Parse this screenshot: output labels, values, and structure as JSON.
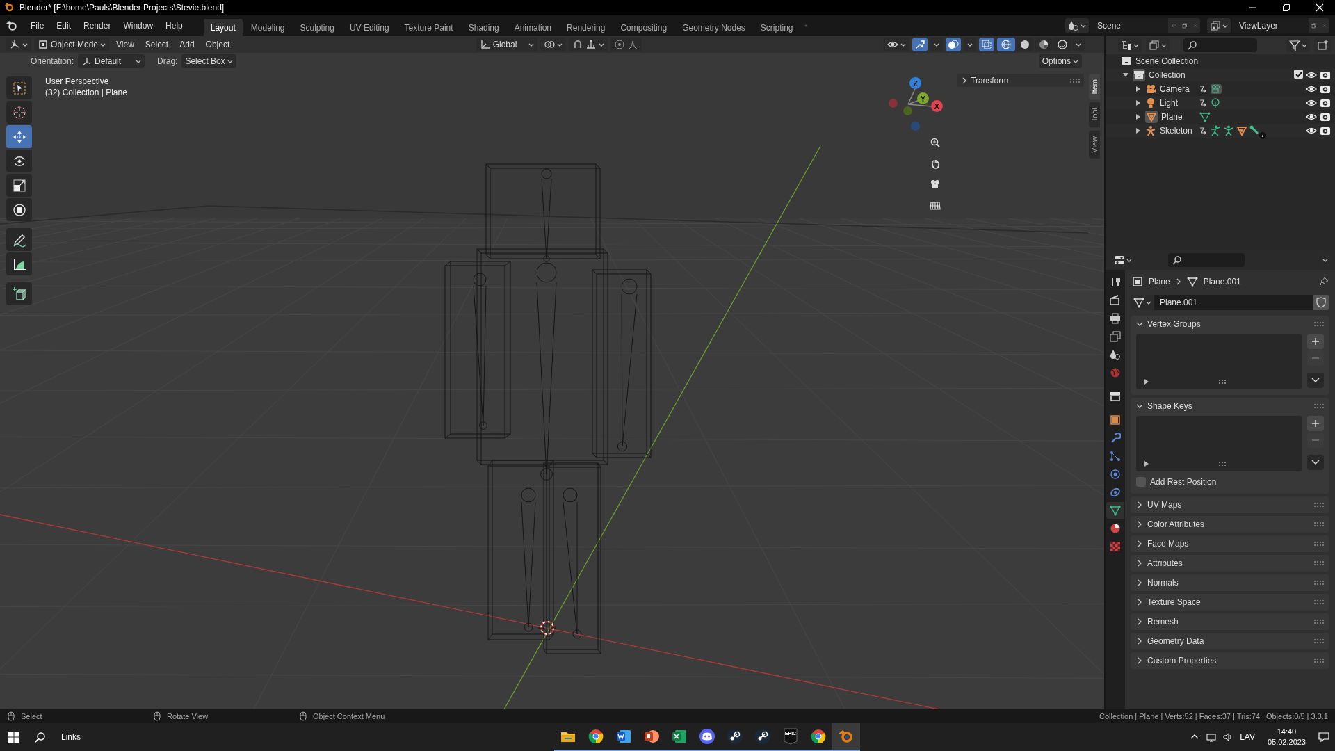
{
  "window": {
    "title": "Blender* [F:\\home\\Pauls\\Blender Projects\\Stevie.blend]"
  },
  "menu": [
    "File",
    "Edit",
    "Render",
    "Window",
    "Help"
  ],
  "workspaces": [
    {
      "label": "Layout",
      "selected": true
    },
    {
      "label": "Modeling",
      "selected": false
    },
    {
      "label": "Sculpting",
      "selected": false
    },
    {
      "label": "UV Editing",
      "selected": false
    },
    {
      "label": "Texture Paint",
      "selected": false
    },
    {
      "label": "Shading",
      "selected": false
    },
    {
      "label": "Animation",
      "selected": false
    },
    {
      "label": "Rendering",
      "selected": false
    },
    {
      "label": "Compositing",
      "selected": false
    },
    {
      "label": "Geometry Nodes",
      "selected": false
    },
    {
      "label": "Scripting",
      "selected": false
    }
  ],
  "scene": "Scene",
  "view_layer": "ViewLayer",
  "viewport": {
    "mode": "Object Mode",
    "menus": [
      "View",
      "Select",
      "Add",
      "Object"
    ],
    "transform_orientation": "Global",
    "toggles": [
      {
        "kind": "gizmo",
        "on": true
      },
      {
        "kind": "overlay",
        "on": true
      },
      {
        "kind": "xray",
        "on": true
      }
    ],
    "shading": [
      {
        "kind": "wireframe",
        "selected": true
      },
      {
        "kind": "solid",
        "selected": false
      },
      {
        "kind": "material",
        "selected": false
      },
      {
        "kind": "rendered",
        "selected": false
      }
    ],
    "orientation_label": "Orientation:",
    "orientation": "Default",
    "drag_label": "Drag:",
    "drag": "Select Box",
    "options": "Options",
    "view_name": "User Perspective",
    "view_info": "(32) Collection | Plane",
    "tools": [
      {
        "kind": "select",
        "selected": false
      },
      {
        "kind": "cursor",
        "selected": false
      },
      {
        "kind": "move",
        "selected": true
      },
      {
        "kind": "rotate",
        "selected": false
      },
      {
        "kind": "scale",
        "selected": false
      },
      {
        "kind": "transform",
        "selected": false
      },
      {
        "kind": "annotate",
        "selected": false
      },
      {
        "kind": "measure",
        "selected": false
      },
      {
        "kind": "add_cube",
        "selected": false
      }
    ],
    "gizmo_axes": [
      {
        "label": "Z",
        "color": "#2f83e0"
      },
      {
        "label": "Y",
        "color": "#7ea82b"
      },
      {
        "label": "X",
        "color": "#e0424f"
      }
    ],
    "sidebar_tabs": [
      {
        "label": "Item",
        "selected": true
      },
      {
        "label": "Tool",
        "selected": false
      },
      {
        "label": "View",
        "selected": false
      }
    ],
    "panel": {
      "title": "Transform",
      "expanded": false
    }
  },
  "outliner": {
    "root": "Scene Collection",
    "tree": [
      {
        "name": "Collection",
        "expanded": true,
        "active": true,
        "checked": true,
        "children": [
          {
            "name": "Camera",
            "kind": "camera",
            "expanded": false,
            "active": false
          },
          {
            "name": "Light",
            "kind": "light",
            "expanded": false,
            "active": false
          },
          {
            "name": "Plane",
            "kind": "mesh",
            "expanded": false,
            "active": true
          },
          {
            "name": "Skeleton",
            "kind": "armature",
            "expanded": false,
            "active": false,
            "badge": "7"
          }
        ]
      }
    ]
  },
  "properties": {
    "breadcrumb": [
      "Plane",
      "Plane.001"
    ],
    "datablock": "Plane.001",
    "tabs": [
      {
        "kind": "tool",
        "selected": false
      },
      {
        "kind": "render",
        "selected": false
      },
      {
        "kind": "output",
        "selected": false
      },
      {
        "kind": "view_layer",
        "selected": false
      },
      {
        "kind": "scene",
        "selected": false
      },
      {
        "kind": "world",
        "selected": false
      },
      {
        "kind": "collection",
        "selected": false
      },
      {
        "kind": "object",
        "selected": false
      },
      {
        "kind": "modifiers",
        "selected": false
      },
      {
        "kind": "particles",
        "selected": false
      },
      {
        "kind": "physics",
        "selected": false
      },
      {
        "kind": "constraints",
        "selected": false
      },
      {
        "kind": "data",
        "selected": true
      },
      {
        "kind": "material",
        "selected": false
      },
      {
        "kind": "texture",
        "selected": false
      }
    ],
    "panels": [
      {
        "title": "Vertex Groups",
        "expanded": true,
        "kind": "list"
      },
      {
        "title": "Shape Keys",
        "expanded": true,
        "kind": "list",
        "checkbox": {
          "label": "Add Rest Position",
          "checked": false
        }
      },
      {
        "title": "UV Maps",
        "expanded": false,
        "kind": "plain"
      },
      {
        "title": "Color Attributes",
        "expanded": false,
        "kind": "plain"
      },
      {
        "title": "Face Maps",
        "expanded": false,
        "kind": "plain"
      },
      {
        "title": "Attributes",
        "expanded": false,
        "kind": "plain"
      },
      {
        "title": "Normals",
        "expanded": false,
        "kind": "plain"
      },
      {
        "title": "Texture Space",
        "expanded": false,
        "kind": "plain"
      },
      {
        "title": "Remesh",
        "expanded": false,
        "kind": "plain"
      },
      {
        "title": "Geometry Data",
        "expanded": false,
        "kind": "plain"
      },
      {
        "title": "Custom Properties",
        "expanded": false,
        "kind": "plain"
      }
    ]
  },
  "status_bar": {
    "hints": [
      "Select",
      "Rotate View",
      "Object Context Menu"
    ],
    "stats": "Collection | Plane | Verts:52 | Faces:37 | Tris:74 | Objects:0/5 | 3.3.1"
  },
  "taskbar": {
    "search": "Links",
    "apps": [
      {
        "kind": "folder",
        "active": false
      },
      {
        "kind": "chrome",
        "active": false
      },
      {
        "kind": "word",
        "active": false
      },
      {
        "kind": "powerpoint",
        "active": false
      },
      {
        "kind": "excel",
        "active": false
      },
      {
        "kind": "discord",
        "active": false
      },
      {
        "kind": "steam",
        "active": false
      },
      {
        "kind": "steam",
        "active": false
      },
      {
        "kind": "epic",
        "label": "EPIC",
        "active": false
      },
      {
        "kind": "chrome",
        "active": false
      },
      {
        "kind": "blender",
        "active": true
      }
    ],
    "language": "LAV",
    "time": "14:40",
    "date": "05.02.2023"
  }
}
